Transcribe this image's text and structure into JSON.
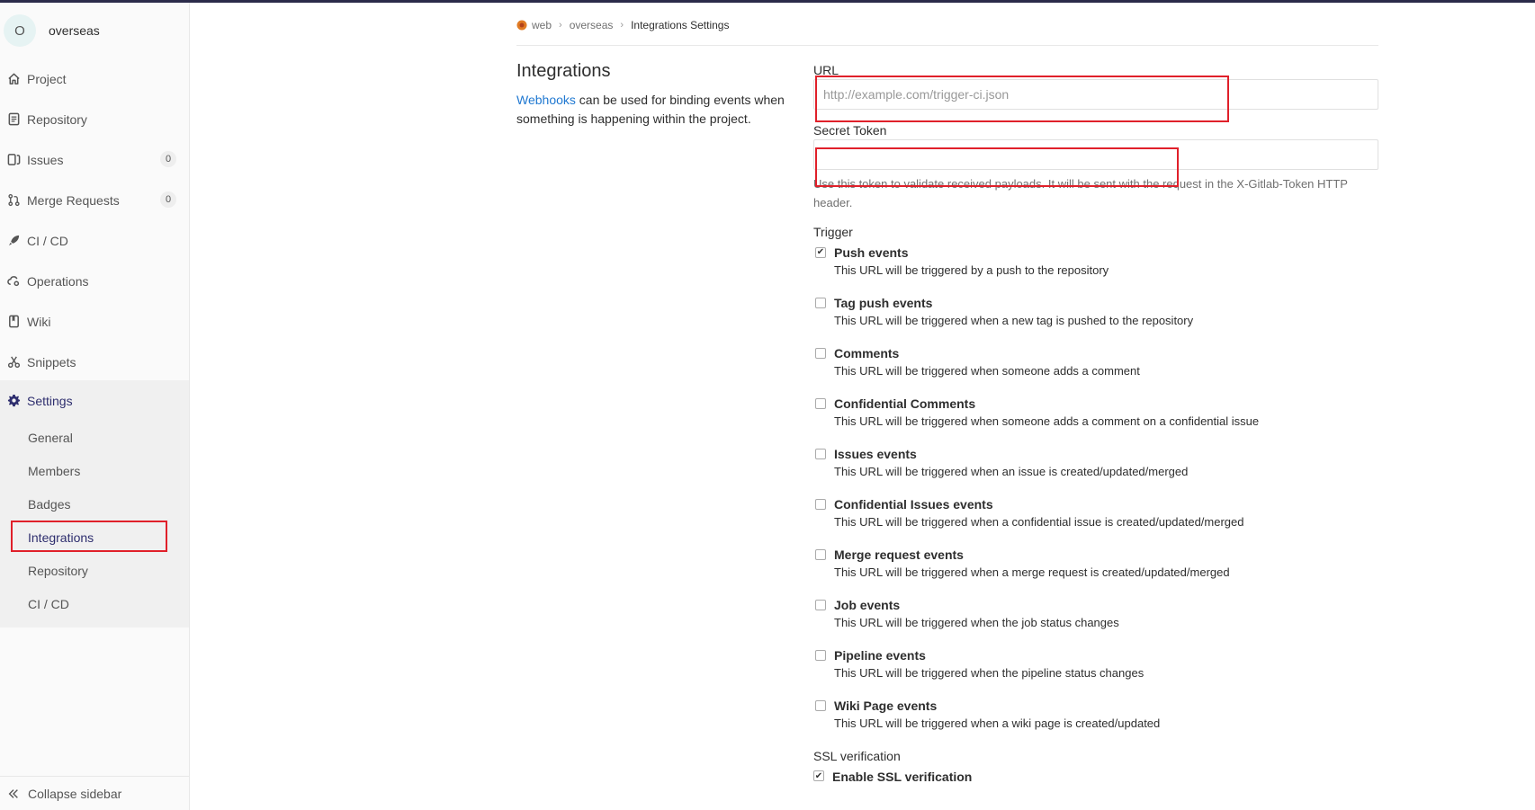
{
  "sidebar": {
    "avatar_letter": "O",
    "project_name": "overseas",
    "items": [
      {
        "label": "Project",
        "icon": "home-icon"
      },
      {
        "label": "Repository",
        "icon": "doc-icon"
      },
      {
        "label": "Issues",
        "icon": "issues-icon",
        "count": "0"
      },
      {
        "label": "Merge Requests",
        "icon": "merge-icon",
        "count": "0"
      },
      {
        "label": "CI / CD",
        "icon": "rocket-icon"
      },
      {
        "label": "Operations",
        "icon": "cloud-gear-icon"
      },
      {
        "label": "Wiki",
        "icon": "book-icon"
      },
      {
        "label": "Snippets",
        "icon": "scissors-icon"
      }
    ],
    "settings": {
      "label": "Settings",
      "sub": [
        "General",
        "Members",
        "Badges",
        "Integrations",
        "Repository",
        "CI / CD"
      ],
      "active": "Integrations"
    },
    "collapse_label": "Collapse sidebar"
  },
  "breadcrumb": {
    "group": "web",
    "project": "overseas",
    "current": "Integrations Settings"
  },
  "intro": {
    "title": "Integrations",
    "link_text": "Webhooks",
    "text_rest": " can be used for binding events when something is happening within the project."
  },
  "form": {
    "url_label": "URL",
    "url_placeholder": "http://example.com/trigger-ci.json",
    "url_value": "",
    "token_label": "Secret Token",
    "token_value": "",
    "token_help": "Use this token to validate received payloads. It will be sent with the request in the X-Gitlab-Token HTTP header.",
    "trigger_label": "Trigger",
    "triggers": [
      {
        "title": "Push events",
        "desc": "This URL will be triggered by a push to the repository",
        "checked": true
      },
      {
        "title": "Tag push events",
        "desc": "This URL will be triggered when a new tag is pushed to the repository",
        "checked": false
      },
      {
        "title": "Comments",
        "desc": "This URL will be triggered when someone adds a comment",
        "checked": false
      },
      {
        "title": "Confidential Comments",
        "desc": "This URL will be triggered when someone adds a comment on a confidential issue",
        "checked": false
      },
      {
        "title": "Issues events",
        "desc": "This URL will be triggered when an issue is created/updated/merged",
        "checked": false
      },
      {
        "title": "Confidential Issues events",
        "desc": "This URL will be triggered when a confidential issue is created/updated/merged",
        "checked": false
      },
      {
        "title": "Merge request events",
        "desc": "This URL will be triggered when a merge request is created/updated/merged",
        "checked": false
      },
      {
        "title": "Job events",
        "desc": "This URL will be triggered when the job status changes",
        "checked": false
      },
      {
        "title": "Pipeline events",
        "desc": "This URL will be triggered when the pipeline status changes",
        "checked": false
      },
      {
        "title": "Wiki Page events",
        "desc": "This URL will be triggered when a wiki page is created/updated",
        "checked": false
      }
    ],
    "ssl_label": "SSL verification",
    "ssl_option": "Enable SSL verification",
    "ssl_checked": true
  },
  "colors": {
    "accent_link": "#1f78d1",
    "highlight": "#e0202a",
    "settings_text": "#2e2e6e"
  }
}
